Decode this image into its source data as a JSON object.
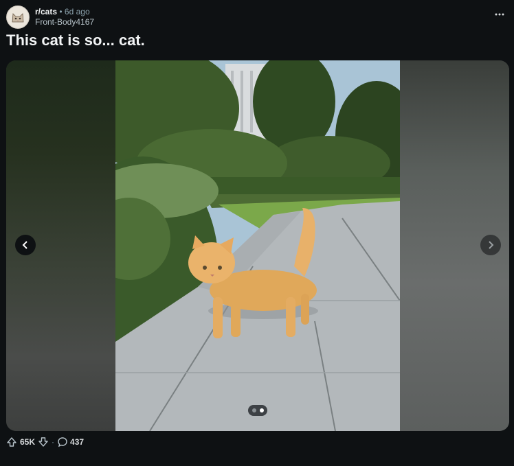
{
  "post": {
    "subreddit": "r/cats",
    "separator": "•",
    "time": "6d ago",
    "author": "Front-Body4167",
    "title": "This cat is so... cat.",
    "more_icon": "more-icon"
  },
  "gallery": {
    "prev_icon": "chevron-left-icon",
    "next_icon": "chevron-right-icon",
    "total": 2,
    "current": 2
  },
  "actions": {
    "upvotes": "65K",
    "separator": "·",
    "comments": "437"
  },
  "colors": {
    "background": "#0e1113",
    "text": "#f2f4f5",
    "muted": "#8ba2ad"
  }
}
